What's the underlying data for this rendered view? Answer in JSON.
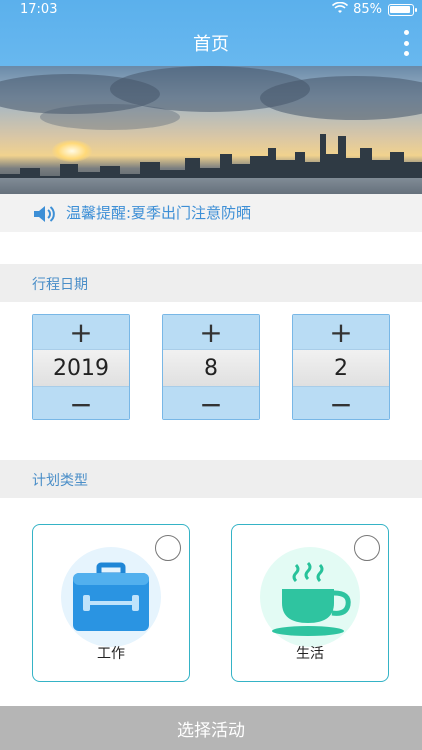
{
  "status": {
    "time": "17:03",
    "battery": "85%",
    "battery_level": 0.85
  },
  "header": {
    "title": "首页"
  },
  "notice": {
    "text": "温馨提醒:夏季出门注意防晒"
  },
  "date_section": {
    "title": "行程日期",
    "plus": "+",
    "minus": "−",
    "year": "2019",
    "month": "8",
    "day": "2"
  },
  "plan_section": {
    "title": "计划类型",
    "work_label": "工作",
    "life_label": "生活"
  },
  "footer": {
    "button": "选择活动"
  },
  "colors": {
    "header": "#5bb0ec",
    "accent_text": "#3d8fd6",
    "picker_btn": "#b9dcf4",
    "card_border": "#35b3c6",
    "bottom_btn": "#b5b5b5"
  }
}
